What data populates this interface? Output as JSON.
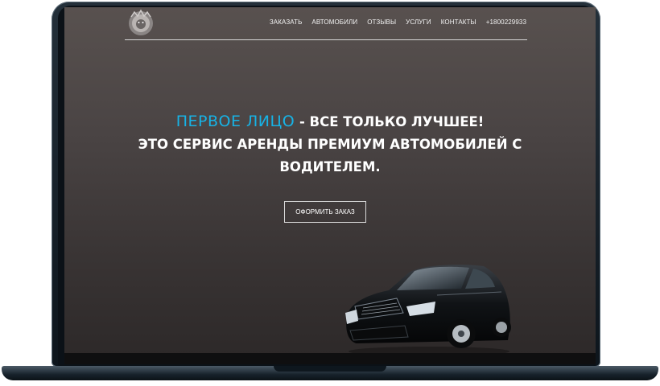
{
  "header": {
    "logo_icon": "lion-head-logo",
    "nav": [
      {
        "label": "ЗАКАЗАТЬ"
      },
      {
        "label": "АВТОМОБИЛИ"
      },
      {
        "label": "ОТЗЫВЫ"
      },
      {
        "label": "УСЛУГИ"
      },
      {
        "label": "КОНТАКТЫ"
      },
      {
        "label": "+1800229933"
      }
    ]
  },
  "hero": {
    "brand": "ПЕРВОЕ ЛИЦО",
    "line1_rest": " - ВСЕ ТОЛЬКО ЛУЧШЕЕ!",
    "line2": "ЭТО СЕРВИС АРЕНДЫ ПРЕМИУМ АВТОМОБИЛЕЙ С",
    "line3": "ВОДИТЕЛЕМ.",
    "cta_label": "ОФОРМИТЬ ЗАКАЗ"
  },
  "image": {
    "car_icon": "black-luxury-sedan"
  },
  "colors": {
    "accent": "#17b3e6",
    "background": "#4a4444",
    "text": "#ffffff"
  }
}
